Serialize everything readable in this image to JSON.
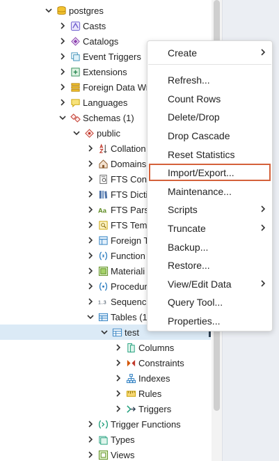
{
  "tree": {
    "items": [
      {
        "label": "postgres",
        "icon": "database-icon"
      },
      {
        "label": "Casts",
        "icon": "casts-icon"
      },
      {
        "label": "Catalogs",
        "icon": "catalogs-icon"
      },
      {
        "label": "Event Triggers",
        "icon": "event-triggers-icon"
      },
      {
        "label": "Extensions",
        "icon": "extensions-icon"
      },
      {
        "label": "Foreign Data Wr",
        "icon": "foreign-data-wrappers-icon"
      },
      {
        "label": "Languages",
        "icon": "languages-icon"
      },
      {
        "label": "Schemas (1)",
        "icon": "schemas-icon"
      },
      {
        "label": "public",
        "icon": "schema-icon"
      },
      {
        "label": "Collation",
        "icon": "collation-icon"
      },
      {
        "label": "Domains",
        "icon": "domains-icon"
      },
      {
        "label": "FTS Conf",
        "icon": "fts-configurations-icon"
      },
      {
        "label": "FTS Dicti",
        "icon": "fts-dictionaries-icon"
      },
      {
        "label": "FTS Pars",
        "icon": "fts-parsers-icon"
      },
      {
        "label": "FTS Tem",
        "icon": "fts-templates-icon"
      },
      {
        "label": "Foreign T",
        "icon": "foreign-tables-icon"
      },
      {
        "label": "Function",
        "icon": "functions-icon"
      },
      {
        "label": "Materiali",
        "icon": "materialized-views-icon"
      },
      {
        "label": "Procedur",
        "icon": "procedures-icon"
      },
      {
        "label": "Sequenc",
        "icon": "sequences-icon"
      },
      {
        "label": "Tables (1",
        "icon": "tables-icon"
      },
      {
        "label": "test",
        "icon": "table-icon"
      },
      {
        "label": "Columns",
        "icon": "columns-icon"
      },
      {
        "label": "Constraints",
        "icon": "constraints-icon"
      },
      {
        "label": "Indexes",
        "icon": "indexes-icon"
      },
      {
        "label": "Rules",
        "icon": "rules-icon"
      },
      {
        "label": "Triggers",
        "icon": "triggers-icon"
      },
      {
        "label": "Trigger Functions",
        "icon": "trigger-functions-icon"
      },
      {
        "label": "Types",
        "icon": "types-icon"
      },
      {
        "label": "Views",
        "icon": "views-icon"
      }
    ]
  },
  "context_menu": {
    "items": [
      {
        "label": "Create",
        "submenu": true
      },
      {
        "label": "Refresh...",
        "submenu": false
      },
      {
        "label": "Count Rows",
        "submenu": false
      },
      {
        "label": "Delete/Drop",
        "submenu": false
      },
      {
        "label": "Drop Cascade",
        "submenu": false
      },
      {
        "label": "Reset Statistics",
        "submenu": false
      },
      {
        "label": "Import/Export...",
        "submenu": false,
        "highlighted": true
      },
      {
        "label": "Maintenance...",
        "submenu": false
      },
      {
        "label": "Scripts",
        "submenu": true
      },
      {
        "label": "Truncate",
        "submenu": true
      },
      {
        "label": "Backup...",
        "submenu": false
      },
      {
        "label": "Restore...",
        "submenu": false
      },
      {
        "label": "View/Edit Data",
        "submenu": true
      },
      {
        "label": "Query Tool...",
        "submenu": false
      },
      {
        "label": "Properties...",
        "submenu": false
      }
    ]
  },
  "colors": {
    "selection_bg": "#dbeaf6",
    "highlight_border": "#d4613a",
    "right_pane_bg": "#ebeef3"
  }
}
